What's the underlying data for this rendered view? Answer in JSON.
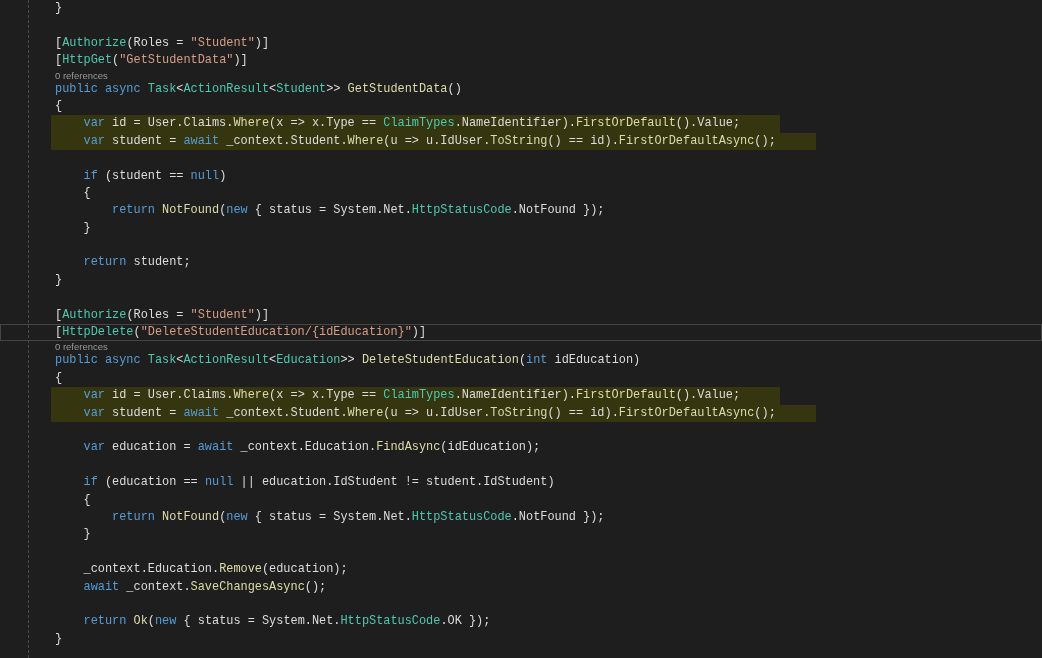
{
  "editor": {
    "lines": [
      {
        "kind": "code",
        "highlighted": false,
        "current": false,
        "tokens": [
          {
            "text": "}",
            "kind": "plain"
          }
        ]
      },
      {
        "kind": "blank"
      },
      {
        "kind": "code",
        "highlighted": false,
        "current": false,
        "tokens": [
          {
            "text": "[",
            "kind": "plain"
          },
          {
            "text": "Authorize",
            "kind": "type"
          },
          {
            "text": "(Roles = ",
            "kind": "plain"
          },
          {
            "text": "\"Student\"",
            "kind": "string"
          },
          {
            "text": ")]",
            "kind": "plain"
          }
        ]
      },
      {
        "kind": "code",
        "highlighted": false,
        "current": false,
        "tokens": [
          {
            "text": "[",
            "kind": "plain"
          },
          {
            "text": "HttpGet",
            "kind": "type"
          },
          {
            "text": "(",
            "kind": "plain"
          },
          {
            "text": "\"GetStudentData\"",
            "kind": "string"
          },
          {
            "text": ")]",
            "kind": "plain"
          }
        ]
      },
      {
        "kind": "codelens",
        "text": "0 references"
      },
      {
        "kind": "code",
        "highlighted": false,
        "current": false,
        "tokens": [
          {
            "text": "public async ",
            "kind": "keyword"
          },
          {
            "text": "Task",
            "kind": "type"
          },
          {
            "text": "<",
            "kind": "plain"
          },
          {
            "text": "ActionResult",
            "kind": "type"
          },
          {
            "text": "<",
            "kind": "plain"
          },
          {
            "text": "Student",
            "kind": "type"
          },
          {
            "text": ">> ",
            "kind": "plain"
          },
          {
            "text": "GetStudentData",
            "kind": "method"
          },
          {
            "text": "()",
            "kind": "plain"
          }
        ]
      },
      {
        "kind": "code",
        "highlighted": false,
        "current": false,
        "tokens": [
          {
            "text": "{",
            "kind": "plain"
          }
        ]
      },
      {
        "kind": "code",
        "highlighted": true,
        "current": false,
        "tokens": [
          {
            "text": "    var",
            "kind": "keyword"
          },
          {
            "text": " id = User.Claims.",
            "kind": "plain"
          },
          {
            "text": "Where",
            "kind": "method"
          },
          {
            "text": "(x => x.Type == ",
            "kind": "plain"
          },
          {
            "text": "ClaimTypes",
            "kind": "type"
          },
          {
            "text": ".NameIdentifier).",
            "kind": "plain"
          },
          {
            "text": "FirstOrDefault",
            "kind": "method"
          },
          {
            "text": "().Value;",
            "kind": "plain"
          }
        ]
      },
      {
        "kind": "code",
        "highlighted": true,
        "current": false,
        "tokens": [
          {
            "text": "    var",
            "kind": "keyword"
          },
          {
            "text": " student = ",
            "kind": "plain"
          },
          {
            "text": "await",
            "kind": "keyword"
          },
          {
            "text": " _context.Student.",
            "kind": "plain"
          },
          {
            "text": "Where",
            "kind": "method"
          },
          {
            "text": "(u => u.IdUser.",
            "kind": "plain"
          },
          {
            "text": "ToString",
            "kind": "method"
          },
          {
            "text": "() == id).",
            "kind": "plain"
          },
          {
            "text": "FirstOrDefaultAsync",
            "kind": "method"
          },
          {
            "text": "();",
            "kind": "plain"
          }
        ]
      },
      {
        "kind": "blank"
      },
      {
        "kind": "code",
        "highlighted": false,
        "current": false,
        "tokens": [
          {
            "text": "    if",
            "kind": "keyword"
          },
          {
            "text": " (student == ",
            "kind": "plain"
          },
          {
            "text": "null",
            "kind": "keyword"
          },
          {
            "text": ")",
            "kind": "plain"
          }
        ]
      },
      {
        "kind": "code",
        "highlighted": false,
        "current": false,
        "tokens": [
          {
            "text": "    {",
            "kind": "plain"
          }
        ]
      },
      {
        "kind": "code",
        "highlighted": false,
        "current": false,
        "tokens": [
          {
            "text": "        return ",
            "kind": "keyword"
          },
          {
            "text": "NotFound",
            "kind": "method"
          },
          {
            "text": "(",
            "kind": "plain"
          },
          {
            "text": "new",
            "kind": "keyword"
          },
          {
            "text": " { status = System.Net.",
            "kind": "plain"
          },
          {
            "text": "HttpStatusCode",
            "kind": "type"
          },
          {
            "text": ".NotFound });",
            "kind": "plain"
          }
        ]
      },
      {
        "kind": "code",
        "highlighted": false,
        "current": false,
        "tokens": [
          {
            "text": "    }",
            "kind": "plain"
          }
        ]
      },
      {
        "kind": "blank"
      },
      {
        "kind": "code",
        "highlighted": false,
        "current": false,
        "tokens": [
          {
            "text": "    return",
            "kind": "keyword"
          },
          {
            "text": " student;",
            "kind": "plain"
          }
        ]
      },
      {
        "kind": "code",
        "highlighted": false,
        "current": false,
        "tokens": [
          {
            "text": "}",
            "kind": "plain"
          }
        ]
      },
      {
        "kind": "blank"
      },
      {
        "kind": "code",
        "highlighted": false,
        "current": false,
        "tokens": [
          {
            "text": "[",
            "kind": "plain"
          },
          {
            "text": "Authorize",
            "kind": "type"
          },
          {
            "text": "(Roles = ",
            "kind": "plain"
          },
          {
            "text": "\"Student\"",
            "kind": "string"
          },
          {
            "text": ")]",
            "kind": "plain"
          }
        ]
      },
      {
        "kind": "code",
        "highlighted": false,
        "current": true,
        "tokens": [
          {
            "text": "[",
            "kind": "plain"
          },
          {
            "text": "HttpDelete",
            "kind": "type"
          },
          {
            "text": "(",
            "kind": "plain"
          },
          {
            "text": "\"DeleteStudentEducation/{idEducation}\"",
            "kind": "string"
          },
          {
            "text": ")]",
            "kind": "plain"
          }
        ]
      },
      {
        "kind": "codelens",
        "text": "0 references"
      },
      {
        "kind": "code",
        "highlighted": false,
        "current": false,
        "tokens": [
          {
            "text": "public async ",
            "kind": "keyword"
          },
          {
            "text": "Task",
            "kind": "type"
          },
          {
            "text": "<",
            "kind": "plain"
          },
          {
            "text": "ActionResult",
            "kind": "type"
          },
          {
            "text": "<",
            "kind": "plain"
          },
          {
            "text": "Education",
            "kind": "type"
          },
          {
            "text": ">> ",
            "kind": "plain"
          },
          {
            "text": "DeleteStudentEducation",
            "kind": "method"
          },
          {
            "text": "(",
            "kind": "plain"
          },
          {
            "text": "int",
            "kind": "keyword"
          },
          {
            "text": " idEducation)",
            "kind": "plain"
          }
        ]
      },
      {
        "kind": "code",
        "highlighted": false,
        "current": false,
        "tokens": [
          {
            "text": "{",
            "kind": "plain"
          }
        ]
      },
      {
        "kind": "code",
        "highlighted": true,
        "current": false,
        "tokens": [
          {
            "text": "    var",
            "kind": "keyword"
          },
          {
            "text": " id = User.Claims.",
            "kind": "plain"
          },
          {
            "text": "Where",
            "kind": "method"
          },
          {
            "text": "(x => x.Type == ",
            "kind": "plain"
          },
          {
            "text": "ClaimTypes",
            "kind": "type"
          },
          {
            "text": ".NameIdentifier).",
            "kind": "plain"
          },
          {
            "text": "FirstOrDefault",
            "kind": "method"
          },
          {
            "text": "().Value;",
            "kind": "plain"
          }
        ]
      },
      {
        "kind": "code",
        "highlighted": true,
        "current": false,
        "tokens": [
          {
            "text": "    var",
            "kind": "keyword"
          },
          {
            "text": " student = ",
            "kind": "plain"
          },
          {
            "text": "await",
            "kind": "keyword"
          },
          {
            "text": " _context.Student.",
            "kind": "plain"
          },
          {
            "text": "Where",
            "kind": "method"
          },
          {
            "text": "(u => u.IdUser.",
            "kind": "plain"
          },
          {
            "text": "ToString",
            "kind": "method"
          },
          {
            "text": "() == id).",
            "kind": "plain"
          },
          {
            "text": "FirstOrDefaultAsync",
            "kind": "method"
          },
          {
            "text": "();",
            "kind": "plain"
          }
        ]
      },
      {
        "kind": "blank"
      },
      {
        "kind": "code",
        "highlighted": false,
        "current": false,
        "tokens": [
          {
            "text": "    var",
            "kind": "keyword"
          },
          {
            "text": " education = ",
            "kind": "plain"
          },
          {
            "text": "await",
            "kind": "keyword"
          },
          {
            "text": " _context.Education.",
            "kind": "plain"
          },
          {
            "text": "FindAsync",
            "kind": "method"
          },
          {
            "text": "(idEducation);",
            "kind": "plain"
          }
        ]
      },
      {
        "kind": "blank"
      },
      {
        "kind": "code",
        "highlighted": false,
        "current": false,
        "tokens": [
          {
            "text": "    if",
            "kind": "keyword"
          },
          {
            "text": " (education == ",
            "kind": "plain"
          },
          {
            "text": "null",
            "kind": "keyword"
          },
          {
            "text": " || education.IdStudent != student.IdStudent)",
            "kind": "plain"
          }
        ]
      },
      {
        "kind": "code",
        "highlighted": false,
        "current": false,
        "tokens": [
          {
            "text": "    {",
            "kind": "plain"
          }
        ]
      },
      {
        "kind": "code",
        "highlighted": false,
        "current": false,
        "tokens": [
          {
            "text": "        return ",
            "kind": "keyword"
          },
          {
            "text": "NotFound",
            "kind": "method"
          },
          {
            "text": "(",
            "kind": "plain"
          },
          {
            "text": "new",
            "kind": "keyword"
          },
          {
            "text": " { status = System.Net.",
            "kind": "plain"
          },
          {
            "text": "HttpStatusCode",
            "kind": "type"
          },
          {
            "text": ".NotFound });",
            "kind": "plain"
          }
        ]
      },
      {
        "kind": "code",
        "highlighted": false,
        "current": false,
        "tokens": [
          {
            "text": "    }",
            "kind": "plain"
          }
        ]
      },
      {
        "kind": "blank"
      },
      {
        "kind": "code",
        "highlighted": false,
        "current": false,
        "tokens": [
          {
            "text": "    _context.Education.",
            "kind": "plain"
          },
          {
            "text": "Remove",
            "kind": "method"
          },
          {
            "text": "(education);",
            "kind": "plain"
          }
        ]
      },
      {
        "kind": "code",
        "highlighted": false,
        "current": false,
        "tokens": [
          {
            "text": "    await",
            "kind": "keyword"
          },
          {
            "text": " _context.",
            "kind": "plain"
          },
          {
            "text": "SaveChangesAsync",
            "kind": "method"
          },
          {
            "text": "();",
            "kind": "plain"
          }
        ]
      },
      {
        "kind": "blank"
      },
      {
        "kind": "code",
        "highlighted": false,
        "current": false,
        "tokens": [
          {
            "text": "    return ",
            "kind": "keyword"
          },
          {
            "text": "Ok",
            "kind": "method"
          },
          {
            "text": "(",
            "kind": "plain"
          },
          {
            "text": "new",
            "kind": "keyword"
          },
          {
            "text": " { status = System.Net.",
            "kind": "plain"
          },
          {
            "text": "HttpStatusCode",
            "kind": "type"
          },
          {
            "text": ".OK });",
            "kind": "plain"
          }
        ]
      },
      {
        "kind": "code",
        "highlighted": false,
        "current": false,
        "tokens": [
          {
            "text": "}",
            "kind": "plain"
          }
        ]
      }
    ]
  }
}
